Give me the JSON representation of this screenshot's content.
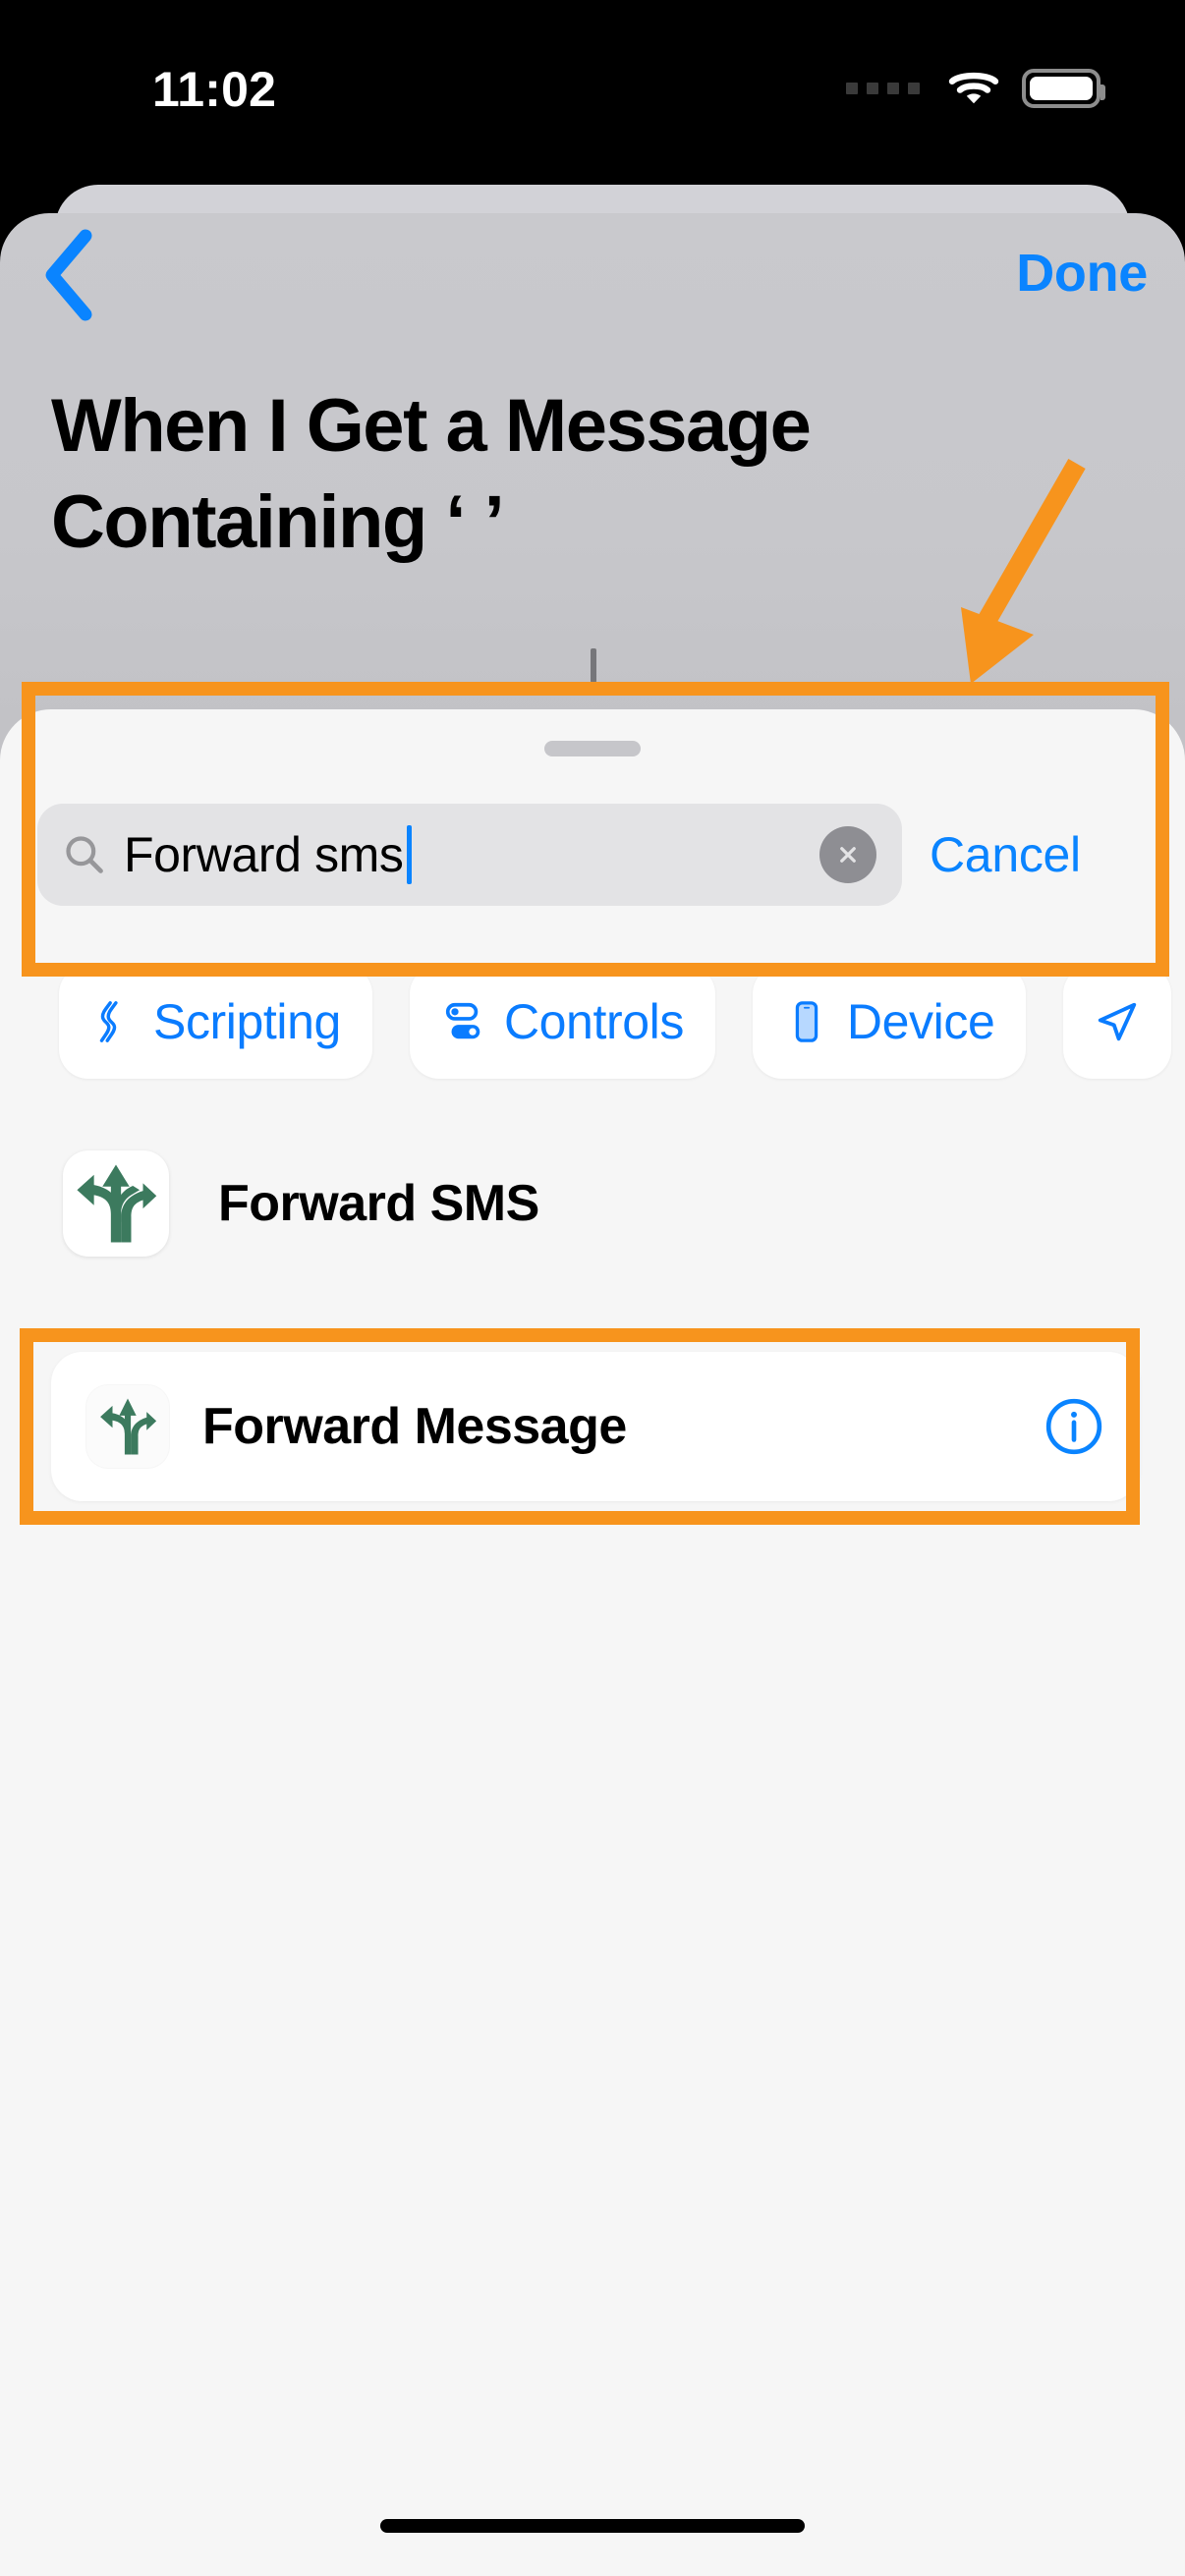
{
  "statusbar": {
    "time": "11:02",
    "signal_icon": "cellular-dots-icon",
    "wifi_icon": "wifi-icon",
    "battery_icon": "battery-full-icon"
  },
  "navbar": {
    "back_icon": "chevron-left-icon",
    "done_label": "Done"
  },
  "header": {
    "title_line1": "When I Get a Message",
    "title_line2": "Containing ‘ ’"
  },
  "sheet": {
    "grabber": "sheet-grabber"
  },
  "search": {
    "value": "Forward sms",
    "placeholder": "Search",
    "search_icon": "magnifying-glass-icon",
    "clear_icon": "clear-circle-icon",
    "cancel_label": "Cancel"
  },
  "chips": [
    {
      "label": "Scripting",
      "icon": "scripting-icon"
    },
    {
      "label": "Controls",
      "icon": "controls-toggle-icon"
    },
    {
      "label": "Device",
      "icon": "device-phone-icon"
    },
    {
      "label": "",
      "icon": "location-arrow-icon"
    }
  ],
  "results": {
    "app": {
      "name": "Forward SMS",
      "icon": "forward-sms-app-icon"
    },
    "action": {
      "name": "Forward Message",
      "icon": "forward-message-action-icon",
      "info_icon": "info-circle-icon"
    }
  },
  "annotations": {
    "highlight_color": "#f7941d",
    "boxes": [
      "search-bar-highlight",
      "forward-message-highlight"
    ],
    "arrow": "arrow-pointing-to-search-bar"
  },
  "colors": {
    "accent_blue": "#0a84ff",
    "chip_blue": "#0a7cff",
    "app_icon_green": "#3c7a5e",
    "annotation_orange": "#f7941d",
    "sheet_bg": "#f6f6f6",
    "header_bg": "#c7c7cb"
  }
}
